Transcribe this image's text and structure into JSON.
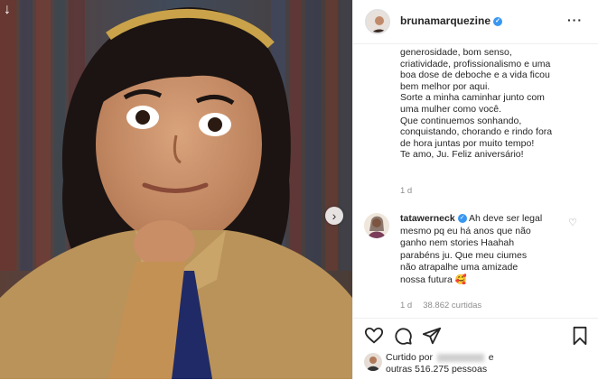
{
  "post": {
    "username": "brunamarquezine",
    "more_label": "···",
    "caption_lines": [
      "generosidade, bom senso,",
      "criatividade, profissionalismo e uma",
      "boa dose de deboche e a vida ficou",
      "bem melhor por aqui.",
      "Sorte a minha caminhar junto com",
      "uma mulher como você.",
      "Que continuemos sonhando,",
      "conquistando, chorando e rindo fora",
      "de hora juntas por muito tempo!",
      "Te amo, Ju. Feliz aniversário!"
    ],
    "caption_time": "1 d"
  },
  "comment": {
    "username": "tatawerneck",
    "lines": [
      "Ah deve ser legal",
      "mesmo pq eu há anos que não",
      "ganho nem stories Haahah",
      "parabéns ju. Que meu ciumes",
      "não atrapalhe uma amizade",
      "nossa futura 🥰"
    ],
    "time": "1 d",
    "likes": "38.862 curtidas"
  },
  "likes": {
    "prefix": "Curtido por",
    "suffix": "e",
    "line2": "outras 516.275 pessoas"
  },
  "icons": {
    "download": "↓",
    "next": "›",
    "heart_small": "♡"
  },
  "colors": {
    "verified": "#3897f0",
    "muted": "#8e8e8e"
  }
}
